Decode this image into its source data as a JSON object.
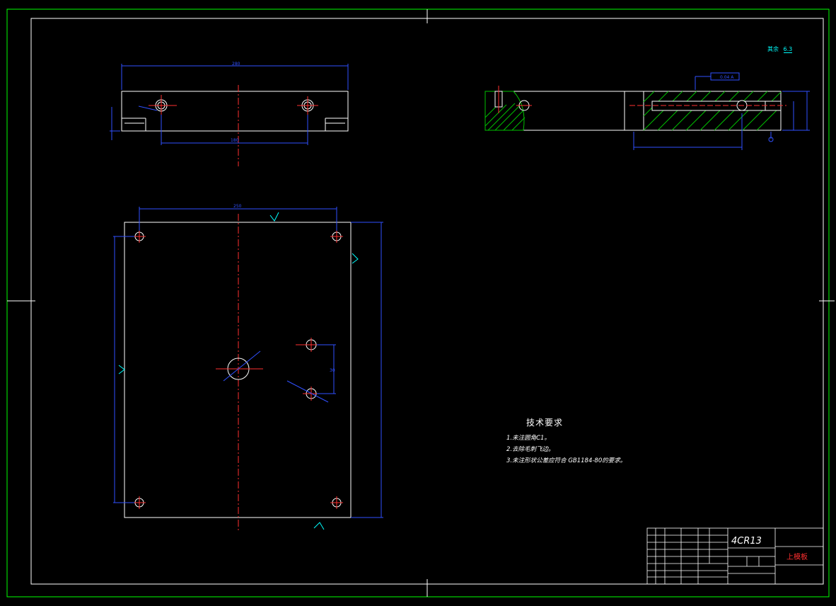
{
  "drawing": {
    "sheet_border_color": "#00ff00",
    "line_color": "#ffffff",
    "centerline_color": "#ff3030",
    "dimension_color": "#3050ff",
    "hatch_color": "#00c000",
    "annotation_color": "#00ffff"
  },
  "general_roughness": {
    "prefix": "其余",
    "value": "6.3"
  },
  "technical_requirements": {
    "title": "技术要求",
    "items": [
      "1.未注圆角C1。",
      "2.去除毛刺飞边。",
      "3.未注形状公差应符合 GB1184-80的要求。"
    ]
  },
  "title_block": {
    "material": "4CR13",
    "part_name": "上模板"
  }
}
